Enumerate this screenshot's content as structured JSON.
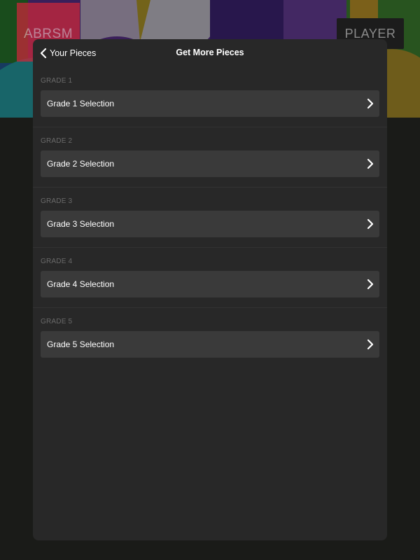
{
  "app": {
    "logo_text": "ABRSM",
    "player_label": "PLAYER"
  },
  "nav": {
    "back_label": "Your Pieces",
    "title": "Get More Pieces"
  },
  "sections": [
    {
      "header": "GRADE 1",
      "row_label": "Grade 1 Selection"
    },
    {
      "header": "GRADE 2",
      "row_label": "Grade 2 Selection"
    },
    {
      "header": "GRADE 3",
      "row_label": "Grade 3 Selection"
    },
    {
      "header": "GRADE 4",
      "row_label": "Grade 4 Selection"
    },
    {
      "header": "GRADE 5",
      "row_label": "Grade 5 Selection"
    }
  ],
  "icons": {
    "back": "chevron-left-icon",
    "row": "chevron-right-icon"
  },
  "colors": {
    "sheet_background": "#282828",
    "row_background": "#3a3a3a",
    "header_text": "#6a6a6a",
    "logo_background": "#c8273a"
  }
}
